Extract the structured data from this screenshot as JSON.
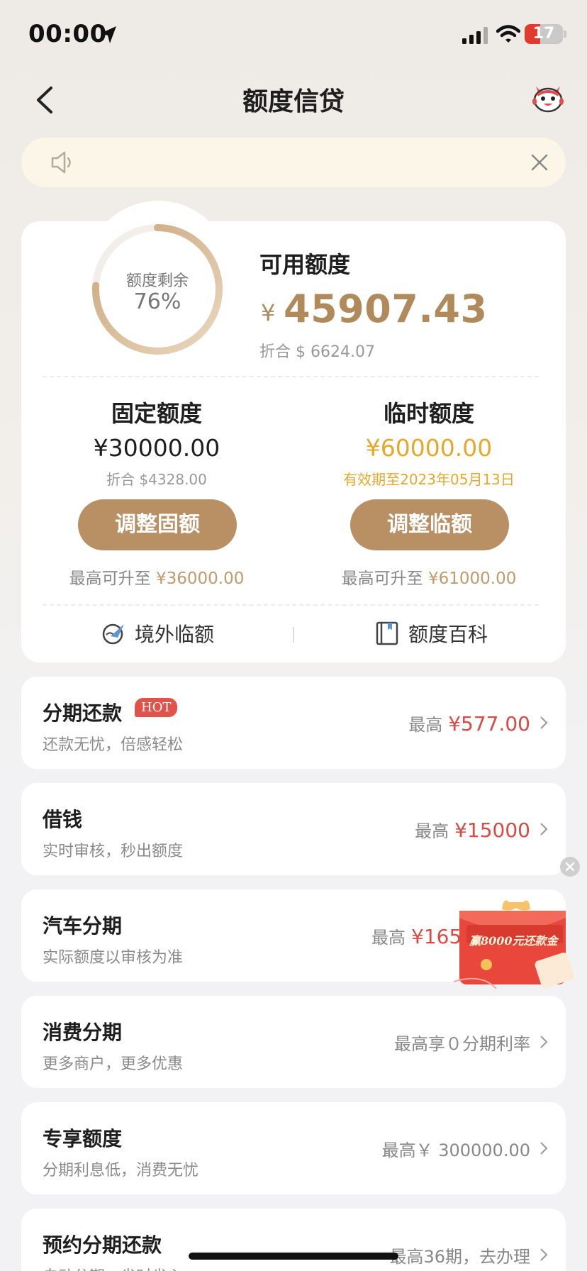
{
  "status_bar": {
    "time": "00:00",
    "battery": "17"
  },
  "nav": {
    "title": "额度信贷"
  },
  "notice": {
    "text": ""
  },
  "credit": {
    "remaining_label": "额度剩余",
    "remaining_pct": "76%",
    "remaining_fraction": 0.76,
    "available_label": "可用额度",
    "currency": "¥",
    "available_amount": "45907.43",
    "available_usd": "折合 $ 6624.07",
    "fixed": {
      "title": "固定额度",
      "amount": "¥30000.00",
      "sub": "折合 $4328.00",
      "button": "调整固额",
      "max_prefix": "最高可升至",
      "max_value": "¥36000.00"
    },
    "temp": {
      "title": "临时额度",
      "amount": "¥60000.00",
      "sub": "有效期至2023年05月13日",
      "button": "调整临额",
      "max_prefix": "最高可升至",
      "max_value": "¥61000.00"
    },
    "links": {
      "overseas": "境外临额",
      "wiki": "额度百科"
    }
  },
  "list": [
    {
      "title": "分期还款",
      "badge": "HOT",
      "sub": "还款无忧，倍感轻松",
      "right_prefix": "最高",
      "right_value": "¥577.00"
    },
    {
      "title": "借钱",
      "sub": "实时审核，秒出额度",
      "right_prefix": "最高",
      "right_value": "¥15000"
    },
    {
      "title": "汽车分期",
      "sub": "实际额度以审核为准",
      "right_prefix": "最高",
      "right_value": "¥165"
    },
    {
      "title": "消费分期",
      "sub": "更多商户，更多优惠",
      "right_text": "最高享０分期利率"
    },
    {
      "title": "专享额度",
      "sub": "分期利息低，消费无忧",
      "right_text": "最高￥ 300000.00"
    },
    {
      "title": "预约分期还款",
      "sub": "自动分期，省时省心",
      "right_text": "最高36期，去办理"
    }
  ],
  "promo": {
    "text": "赢8000元还款金"
  },
  "colors": {
    "gold": "#b99063",
    "red": "#d94a45",
    "amber": "#e6a82a"
  }
}
